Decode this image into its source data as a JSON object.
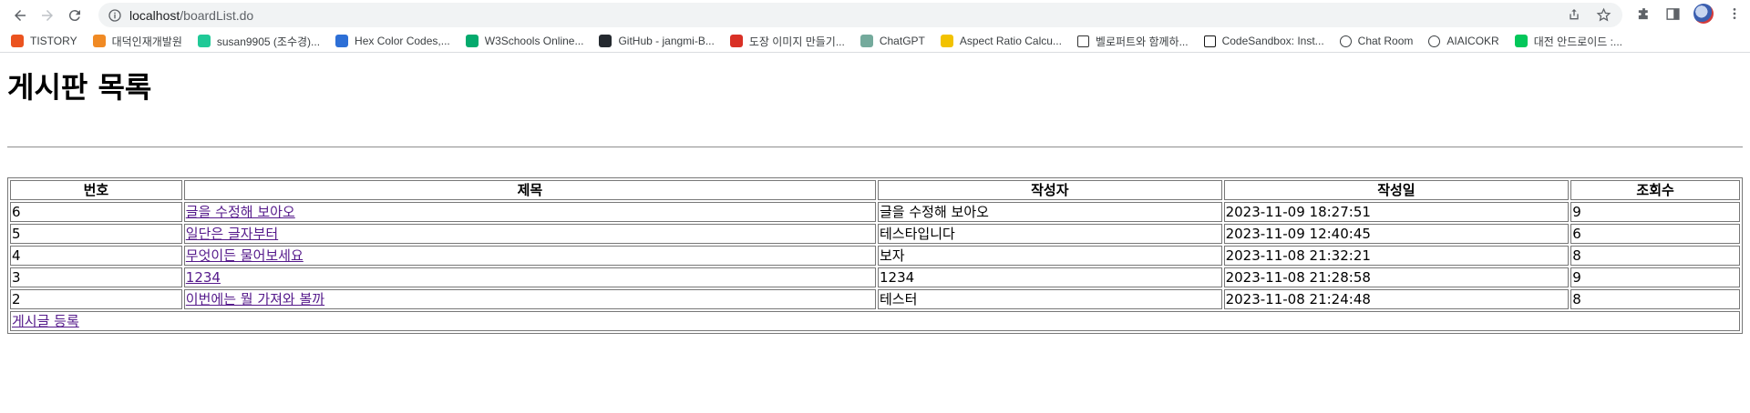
{
  "browser": {
    "url_host": "localhost",
    "url_path": "/boardList.do",
    "bookmarks": [
      {
        "label": "TISTORY",
        "icon": "tistory-icon",
        "color": "#eb531f"
      },
      {
        "label": "대덕인재개발원",
        "icon": "ddit-icon",
        "color": "#f08a24"
      },
      {
        "label": "susan9905 (조수경)...",
        "icon": "velog-icon",
        "color": "#20c997"
      },
      {
        "label": "Hex Color Codes,...",
        "icon": "hex-color-icon",
        "color": "#2d6fd6"
      },
      {
        "label": "W3Schools Online...",
        "icon": "w3schools-icon",
        "color": "#04aa6d"
      },
      {
        "label": "GitHub - jangmi-B...",
        "icon": "github-icon",
        "color": "#24292f"
      },
      {
        "label": "도장 이미지 만들기...",
        "icon": "stamp-icon",
        "color": "#d93025"
      },
      {
        "label": "ChatGPT",
        "icon": "chatgpt-icon",
        "color": "#74aa9c"
      },
      {
        "label": "Aspect Ratio Calcu...",
        "icon": "aspect-ratio-icon",
        "color": "#f2c200"
      },
      {
        "label": "벨로퍼트와 함께하...",
        "icon": "book-icon",
        "color": "#333333"
      },
      {
        "label": "CodeSandbox: Inst...",
        "icon": "codesandbox-icon",
        "color": "#151515"
      },
      {
        "label": "Chat Room",
        "icon": "globe-icon",
        "color": "#3c4043"
      },
      {
        "label": "AIAICOKR",
        "icon": "globe-icon",
        "color": "#3c4043"
      },
      {
        "label": "대전 안드로이드 :...",
        "icon": "cafe-icon",
        "color": "#03c75a"
      }
    ]
  },
  "page": {
    "title": "게시판 목록",
    "table": {
      "headers": [
        "번호",
        "제목",
        "작성자",
        "작성일",
        "조회수"
      ],
      "rows": [
        {
          "no": "6",
          "title": "글을 수정해 보아오",
          "writer": "글을 수정해 보아오",
          "date": "2023-11-09 18:27:51",
          "views": "9"
        },
        {
          "no": "5",
          "title": "일단은 글자부터",
          "writer": "테스타입니다",
          "date": "2023-11-09 12:40:45",
          "views": "6"
        },
        {
          "no": "4",
          "title": "무엇이든 물어보세요",
          "writer": "보자",
          "date": "2023-11-08 21:32:21",
          "views": "8"
        },
        {
          "no": "3",
          "title": "1234",
          "writer": "1234",
          "date": "2023-11-08 21:28:58",
          "views": "9"
        },
        {
          "no": "2",
          "title": "이번에는 뭘 가져와 볼까",
          "writer": "테스터",
          "date": "2023-11-08 21:24:48",
          "views": "8"
        }
      ],
      "register_link": "게시글 등록"
    }
  }
}
